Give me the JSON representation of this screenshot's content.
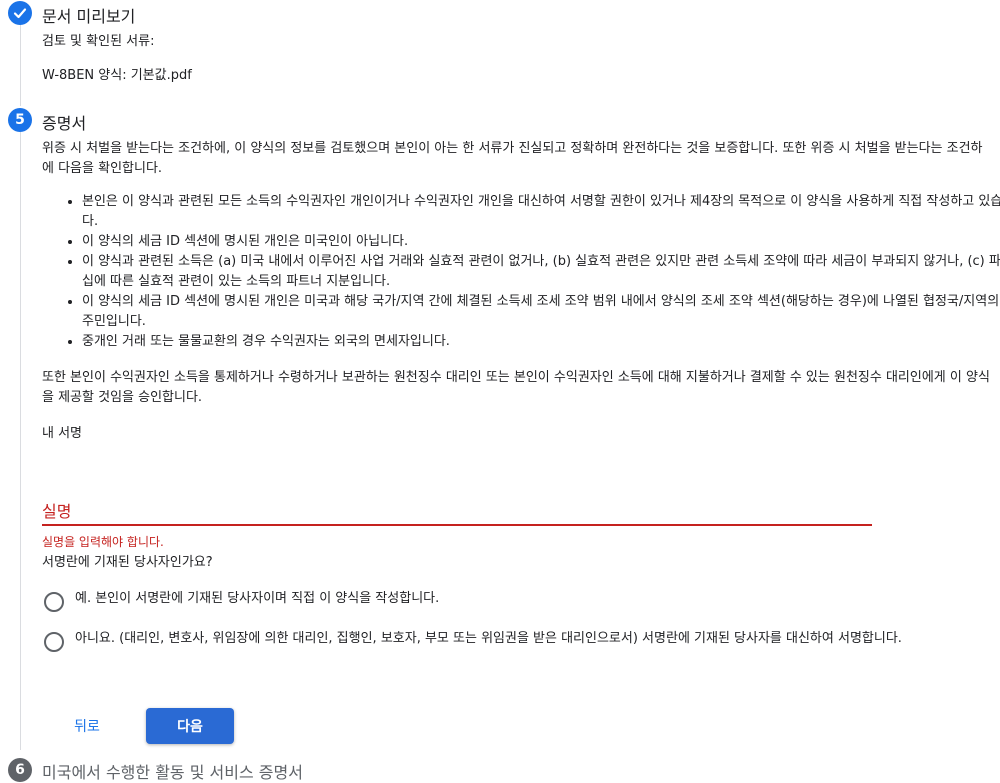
{
  "colors": {
    "accent": "#1a73e8",
    "primary_button": "#2a6ad4",
    "error": "#c5221f",
    "step_inactive": "#5f6368",
    "divider": "#dadce0"
  },
  "preview_step": {
    "icon": "check-icon",
    "title": "문서 미리보기",
    "reviewed_label": "검토 및 확인된 서류:",
    "file_name": "W-8BEN 양식: 기본값.pdf"
  },
  "cert_step": {
    "number": "5",
    "title": "증명서",
    "intro": "위증 시 처벌을 받는다는 조건하에, 이 양식의 정보를 검토했으며 본인이 아는 한 서류가 진실되고 정확하며 완전하다는 것을 보증합니다. 또한 위증 시 처벌을 받는다는 조건하에 다음을 확인합니다.",
    "bullets": [
      "본인은 이 양식과 관련된 모든 소득의 수익권자인 개인이거나 수익권자인 개인을 대신하여 서명할 권한이 있거나 제4장의 목적으로 이 양식을 사용하게 직접 작성하고 있습니다.",
      "이 양식의 세금 ID 섹션에 명시된 개인은 미국인이 아닙니다.",
      "이 양식과 관련된 소득은 (a) 미국 내에서 이루어진 사업 거래와 실효적 관련이 없거나, (b) 실효적 관련은 있지만 관련 소득세 조약에 따라 세금이 부과되지 않거나, (c) 파트너십에 따른 실효적 관련이 있는 소득의 파트너 지분입니다.",
      "이 양식의 세금 ID 섹션에 명시된 개인은 미국과 해당 국가/지역 간에 체결된 소득세 조세 조약 범위 내에서 양식의 조세 조약 섹션(해당하는 경우)에 나열된 협정국/지역의 거주민입니다.",
      "중개인 거래 또는 물물교환의 경우 수익권자는 외국의 면세자입니다."
    ],
    "authorization": "또한 본인이 수익권자인 소득을 통제하거나 수령하거나 보관하는 원천징수 대리인 또는 본인이 수익권자인 소득에 대해 지불하거나 결제할 수 있는 원천징수 대리인에게 이 양식을 제공할 것임을 승인합니다.",
    "signature_heading": "내 서명",
    "name_field_label": "실명",
    "name_field_value": "",
    "name_error": "실명을 입력해야 합니다.",
    "signer_question": "서명란에 기재된 당사자인가요?",
    "options": [
      "예. 본인이 서명란에 기재된 당사자이며 직접 이 양식을 작성합니다.",
      "아니요. (대리인, 변호사, 위임장에 의한 대리인, 집행인, 보호자, 부모 또는 위임권을 받은 대리인으로서) 서명란에 기재된 당사자를 대신하여 서명합니다."
    ],
    "back_label": "뒤로",
    "next_label": "다음"
  },
  "next_step": {
    "number": "6",
    "title": "미국에서 수행한 활동 및 서비스 증명서"
  }
}
